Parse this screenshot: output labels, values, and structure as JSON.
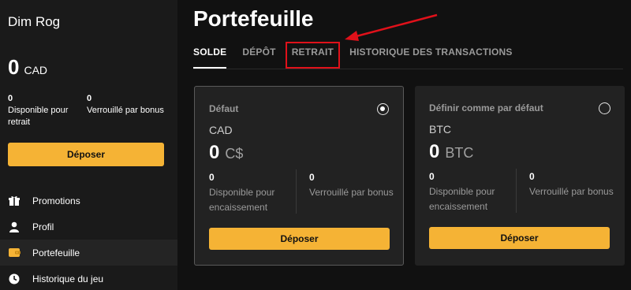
{
  "user": {
    "name": "Dim Rog"
  },
  "balance": {
    "amount": "0",
    "currency": "CAD"
  },
  "sidebar_stats": [
    {
      "value": "0",
      "label": "Disponible pour retrait"
    },
    {
      "value": "0",
      "label": "Verrouillé par bonus"
    }
  ],
  "sidebar_button": "Déposer",
  "nav": [
    {
      "label": "Promotions",
      "icon": "gift-icon"
    },
    {
      "label": "Profil",
      "icon": "user-icon"
    },
    {
      "label": "Portefeuille",
      "icon": "wallet-icon",
      "active": true
    },
    {
      "label": "Historique du jeu",
      "icon": "clock-icon"
    }
  ],
  "page_title": "Portefeuille",
  "tabs": [
    {
      "label": "SOLDE",
      "active": true
    },
    {
      "label": "DÉPÔT"
    },
    {
      "label": "RETRAIT",
      "highlighted": true
    },
    {
      "label": "HISTORIQUE DES TRANSACTIONS"
    }
  ],
  "wallets": [
    {
      "header": "Défaut",
      "currency": "CAD",
      "amount": "0",
      "symbol": "C$",
      "selected": true,
      "stats": [
        {
          "value": "0",
          "label": "Disponible pour encaissement"
        },
        {
          "value": "0",
          "label": "Verrouillé par bonus"
        }
      ],
      "button": "Déposer"
    },
    {
      "header": "Définir comme par défaut",
      "currency": "BTC",
      "amount": "0",
      "symbol": "BTC",
      "selected": false,
      "stats": [
        {
          "value": "0",
          "label": "Disponible pour encaissement"
        },
        {
          "value": "0",
          "label": "Verrouillé par bonus"
        }
      ],
      "button": "Déposer"
    }
  ],
  "colors": {
    "accent": "#f5b335",
    "highlight": "#e0111a",
    "background": "#111111",
    "sidebar": "#1a1a1a",
    "card": "#222222"
  }
}
